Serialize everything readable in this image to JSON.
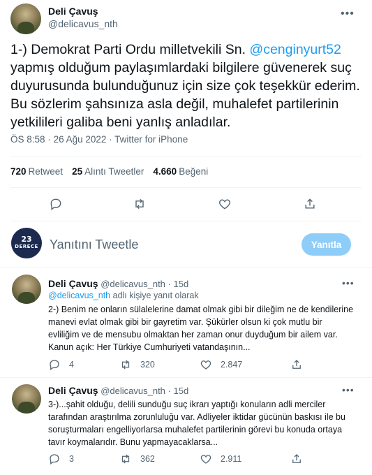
{
  "tweet": {
    "author_name": "Deli Çavuş",
    "author_handle": "@delicavus_nth",
    "text_before": "1-) Demokrat Parti Ordu milletvekili Sn. ",
    "mention": "@cenginyurt52",
    "text_after": " yapmış olduğum paylaşımlardaki bilgilere güvenerek suç duyurusunda bulunduğunuz için size çok teşekkür ederim. Bu sözlerim şahsınıza asla değil, muhalefet partilerinin yetkilileri galiba beni yanlış anladılar.",
    "time": "ÖS 8:58",
    "sep1": "·",
    "date": "26 Ağu 2022",
    "sep2": "·",
    "source": "Twitter for iPhone",
    "retweets": "720",
    "retweets_label": "Retweet",
    "quotes": "25",
    "quotes_label": "Alıntı Tweetler",
    "likes": "4.660",
    "likes_label": "Beğeni",
    "more_icon": "more-icon"
  },
  "reply_composer": {
    "logo_top": "23",
    "logo_bottom": "DERECE",
    "placeholder": "Yanıtını Tweetle",
    "button_label": "Yanıtla"
  },
  "replies": [
    {
      "author_name": "Deli Çavuş",
      "author_handle": "@delicavus_nth",
      "sep": "·",
      "age": "15d",
      "replying_handle": "@delicavus_nth",
      "replying_suffix": " adlı kişiye yanıt olarak",
      "text": "2-) Benim ne onların sülalelerine damat olmak gibi bir dileğim ne de kendilerine manevi evlat olmak gibi bir gayretim var. Şükürler olsun ki çok mutlu bir evliliğim ve de mensubu olmaktan her zaman onur duyduğum bir ailem var. Kanun açık: Her Türkiye Cumhuriyeti vatandaşının...",
      "replies": "4",
      "retweets": "320",
      "likes": "2.847"
    },
    {
      "author_name": "Deli Çavuş",
      "author_handle": "@delicavus_nth",
      "sep": "·",
      "age": "15d",
      "text": "3-)...şahit olduğu, delili sunduğu suç ikrarı yaptığı konuların adli merciler tarafından araştırılma zorunluluğu var. Adliyeler iktidar gücünün baskısı ile bu soruşturmaları engelliyorlarsa muhalefet partilerinin görevi bu konuda ortaya tavır koymalarıdır. Bunu yapmayacaklarsa...",
      "replies": "3",
      "retweets": "362",
      "likes": "2.911"
    }
  ],
  "colors": {
    "accent": "#1d9bf0",
    "muted": "#536471",
    "button_disabled": "#8ecdf8",
    "divider": "#eff3f4"
  }
}
